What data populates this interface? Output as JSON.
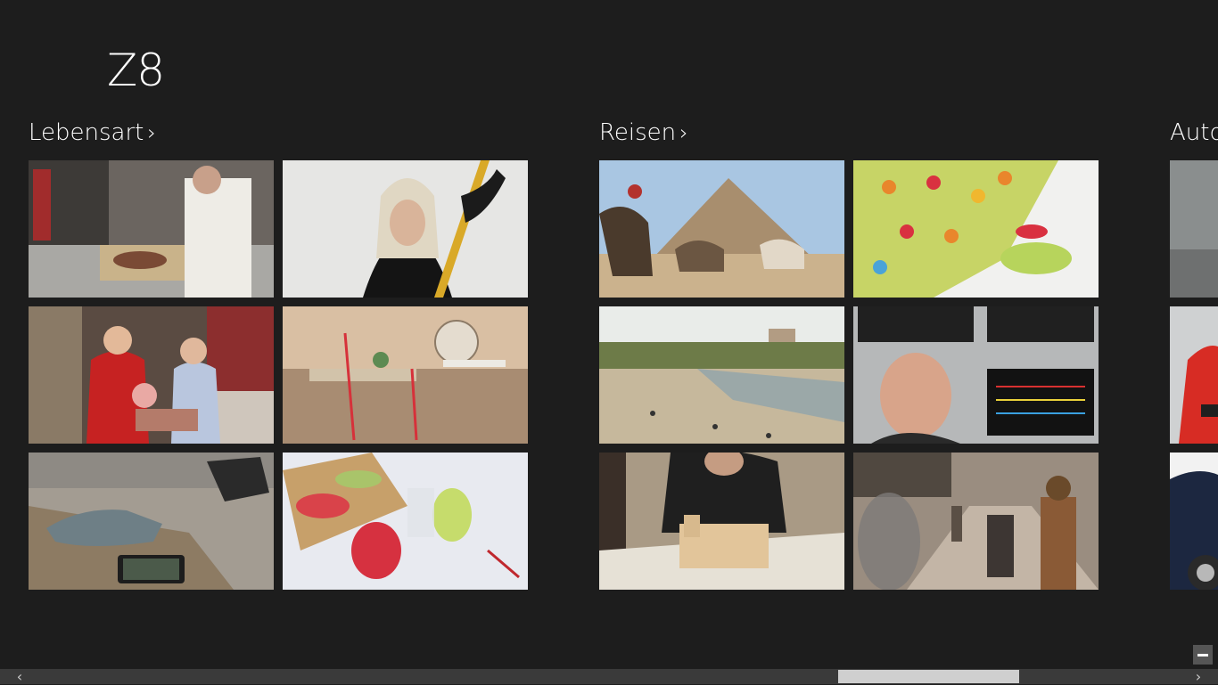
{
  "app": {
    "title": "Z8"
  },
  "sections": [
    {
      "label": "Lebensart",
      "chevron": "›"
    },
    {
      "label": "Reisen",
      "chevron": "›"
    },
    {
      "label": "Auto"
    }
  ],
  "icons": {
    "chevron": "chevron-right-icon",
    "minus": "minus-icon",
    "scroll_left": "chevron-left-icon",
    "scroll_right": "chevron-right-icon"
  },
  "scrollbar": {
    "left_arrow": "‹",
    "right_arrow": "›"
  }
}
